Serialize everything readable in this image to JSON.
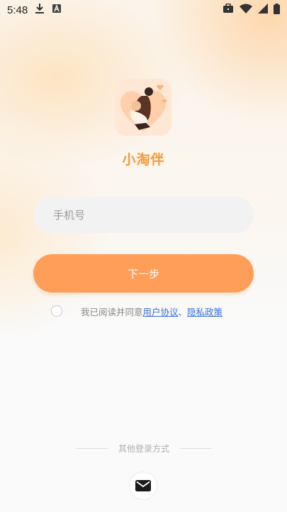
{
  "status_bar": {
    "time": "5:48",
    "icons": [
      "download-icon",
      "a-box-icon",
      "briefcase-icon",
      "wifi-icon",
      "cell-signal-icon",
      "battery-icon"
    ]
  },
  "app": {
    "name": "小淘伴",
    "logo": "couple-heart-logo"
  },
  "form": {
    "phone_placeholder": "手机号",
    "phone_value": "",
    "next_label": "下一步"
  },
  "agreement": {
    "prefix": "我已阅读并同意",
    "user_agreement": "用户协议",
    "separator": "、",
    "privacy_policy": "隐私政策",
    "checked": false
  },
  "other_login": {
    "label": "其他登录方式",
    "methods": [
      "mail-icon"
    ]
  },
  "colors": {
    "accent": "#ff9e58",
    "title": "#f59a3b",
    "link": "#3a6fd8"
  }
}
